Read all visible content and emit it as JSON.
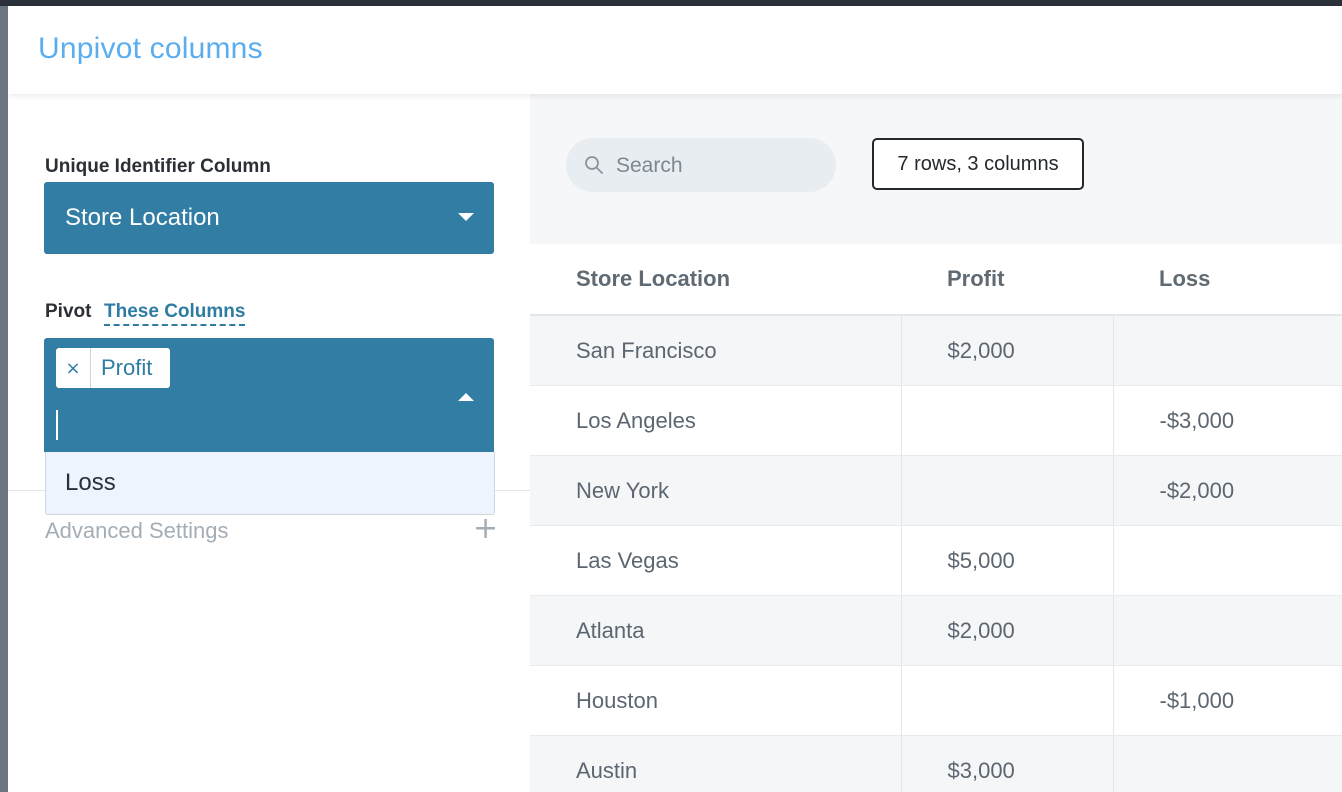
{
  "modal": {
    "title": "Unpivot columns"
  },
  "left": {
    "uid_label": "Unique Identifier Column",
    "uid_value": "Store Location",
    "pivot_label": "Pivot",
    "pivot_link": "These Columns",
    "selected_tags": [
      {
        "remove": "×",
        "label": "Profit"
      }
    ],
    "options": [
      "Loss"
    ],
    "advanced_label": "Advanced Settings",
    "advanced_toggle": "+"
  },
  "right": {
    "search_placeholder": "Search",
    "row_count": "7 rows, 3 columns",
    "table": {
      "headers": [
        "Store Location",
        "Profit",
        "Loss"
      ],
      "rows": [
        [
          "San Francisco",
          "$2,000",
          ""
        ],
        [
          "Los Angeles",
          "",
          "-$3,000"
        ],
        [
          "New York",
          "",
          "-$2,000"
        ],
        [
          "Las Vegas",
          "$5,000",
          ""
        ],
        [
          "Atlanta",
          "$2,000",
          ""
        ],
        [
          "Houston",
          "",
          "-$1,000"
        ],
        [
          "Austin",
          "$3,000",
          ""
        ]
      ]
    }
  }
}
